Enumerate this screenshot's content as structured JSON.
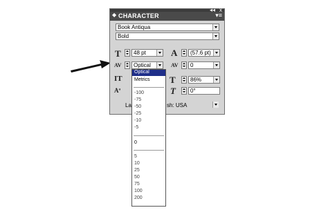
{
  "panel": {
    "title": "CHARACTER",
    "collapse_glyph": "◆",
    "double_arrows": "◂◂",
    "close": "x",
    "menu_glyph": "▾≡",
    "font_family": "Book Antiqua",
    "font_style": "Bold",
    "font_size": "48 pt",
    "leading": "(57.6 pt)",
    "kerning": "Optical",
    "tracking": "0",
    "horizontal_scale": "86%",
    "skew": "0°",
    "language_left": "La",
    "language_right": "sh: USA"
  },
  "icons": {
    "font_size": "T",
    "leading": "A",
    "kerning": "AV",
    "tracking": "AV",
    "vertical_scale": "IT",
    "horizontal_scale": "T",
    "baseline_shift": "Aª",
    "skew": "T"
  },
  "kerning_options": {
    "selected": "Optical",
    "top": [
      "Metrics"
    ],
    "negatives": [
      "-100",
      "-75",
      "-50",
      "-25",
      "-10",
      "-5"
    ],
    "zero": "0",
    "positives": [
      "5",
      "10",
      "25",
      "50",
      "75",
      "100",
      "200"
    ]
  }
}
